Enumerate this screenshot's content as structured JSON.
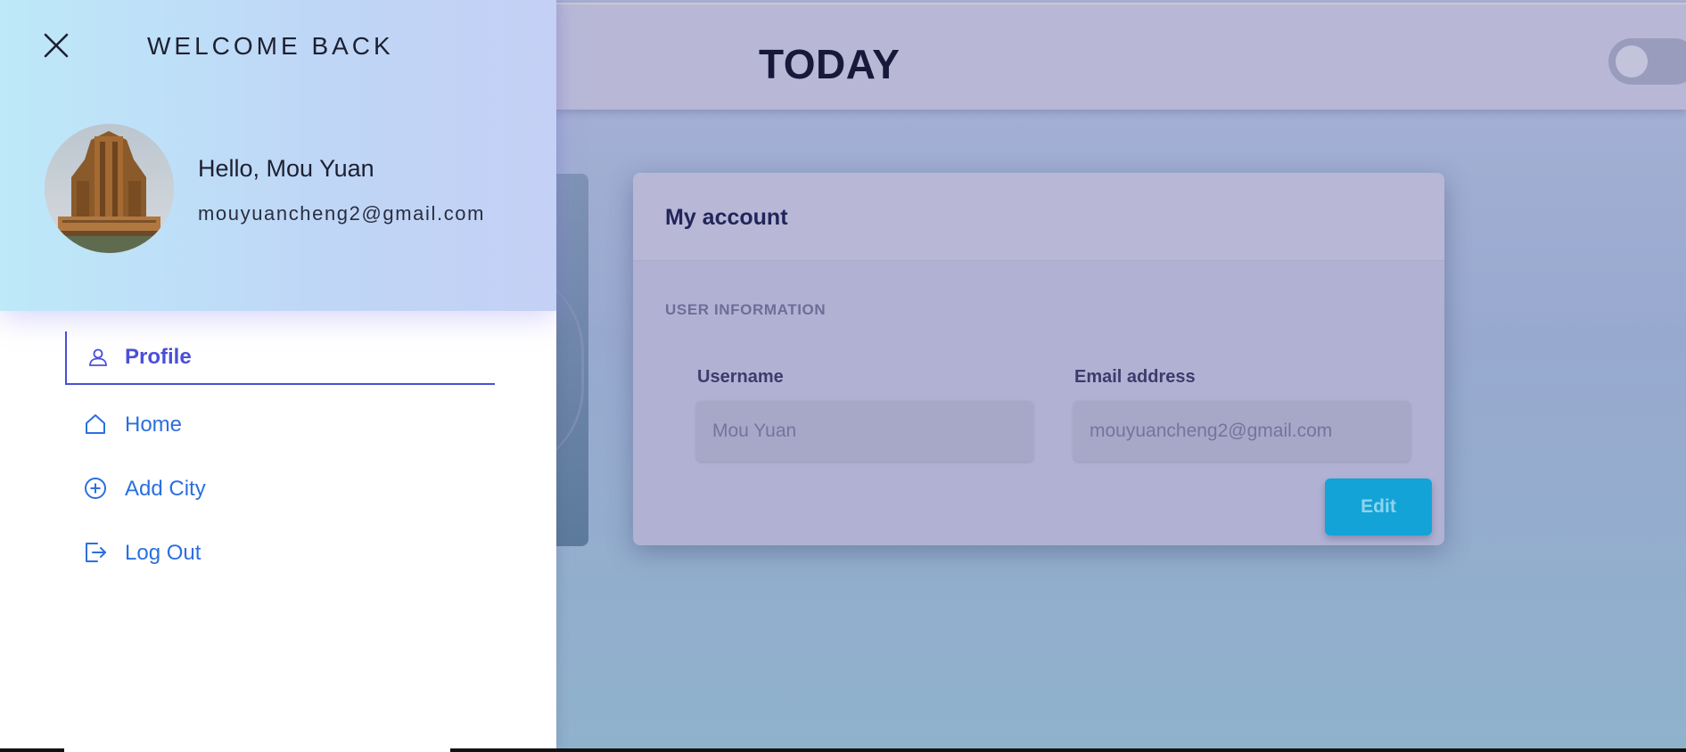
{
  "header": {
    "title": "TODAY",
    "theme_toggle_on": false
  },
  "account": {
    "title": "My account",
    "section_label": "USER INFORMATION",
    "username_label": "Username",
    "username_value": "Mou Yuan",
    "email_label": "Email address",
    "email_value": "mouyuancheng2@gmail.com",
    "edit_label": "Edit"
  },
  "drawer": {
    "welcome": "WELCOME BACK",
    "greeting": "Hello, Mou Yuan",
    "email": "mouyuancheng2@gmail.com",
    "nav": [
      {
        "label": "Profile",
        "icon": "user-icon",
        "active": true
      },
      {
        "label": "Home",
        "icon": "home-icon",
        "active": false
      },
      {
        "label": "Add City",
        "icon": "add-circle-icon",
        "active": false
      },
      {
        "label": "Log Out",
        "icon": "logout-icon",
        "active": false
      }
    ]
  },
  "colors": {
    "accent": "#4a4fd8",
    "link": "#2b6fe0",
    "edit_button": "#13a3d6"
  }
}
